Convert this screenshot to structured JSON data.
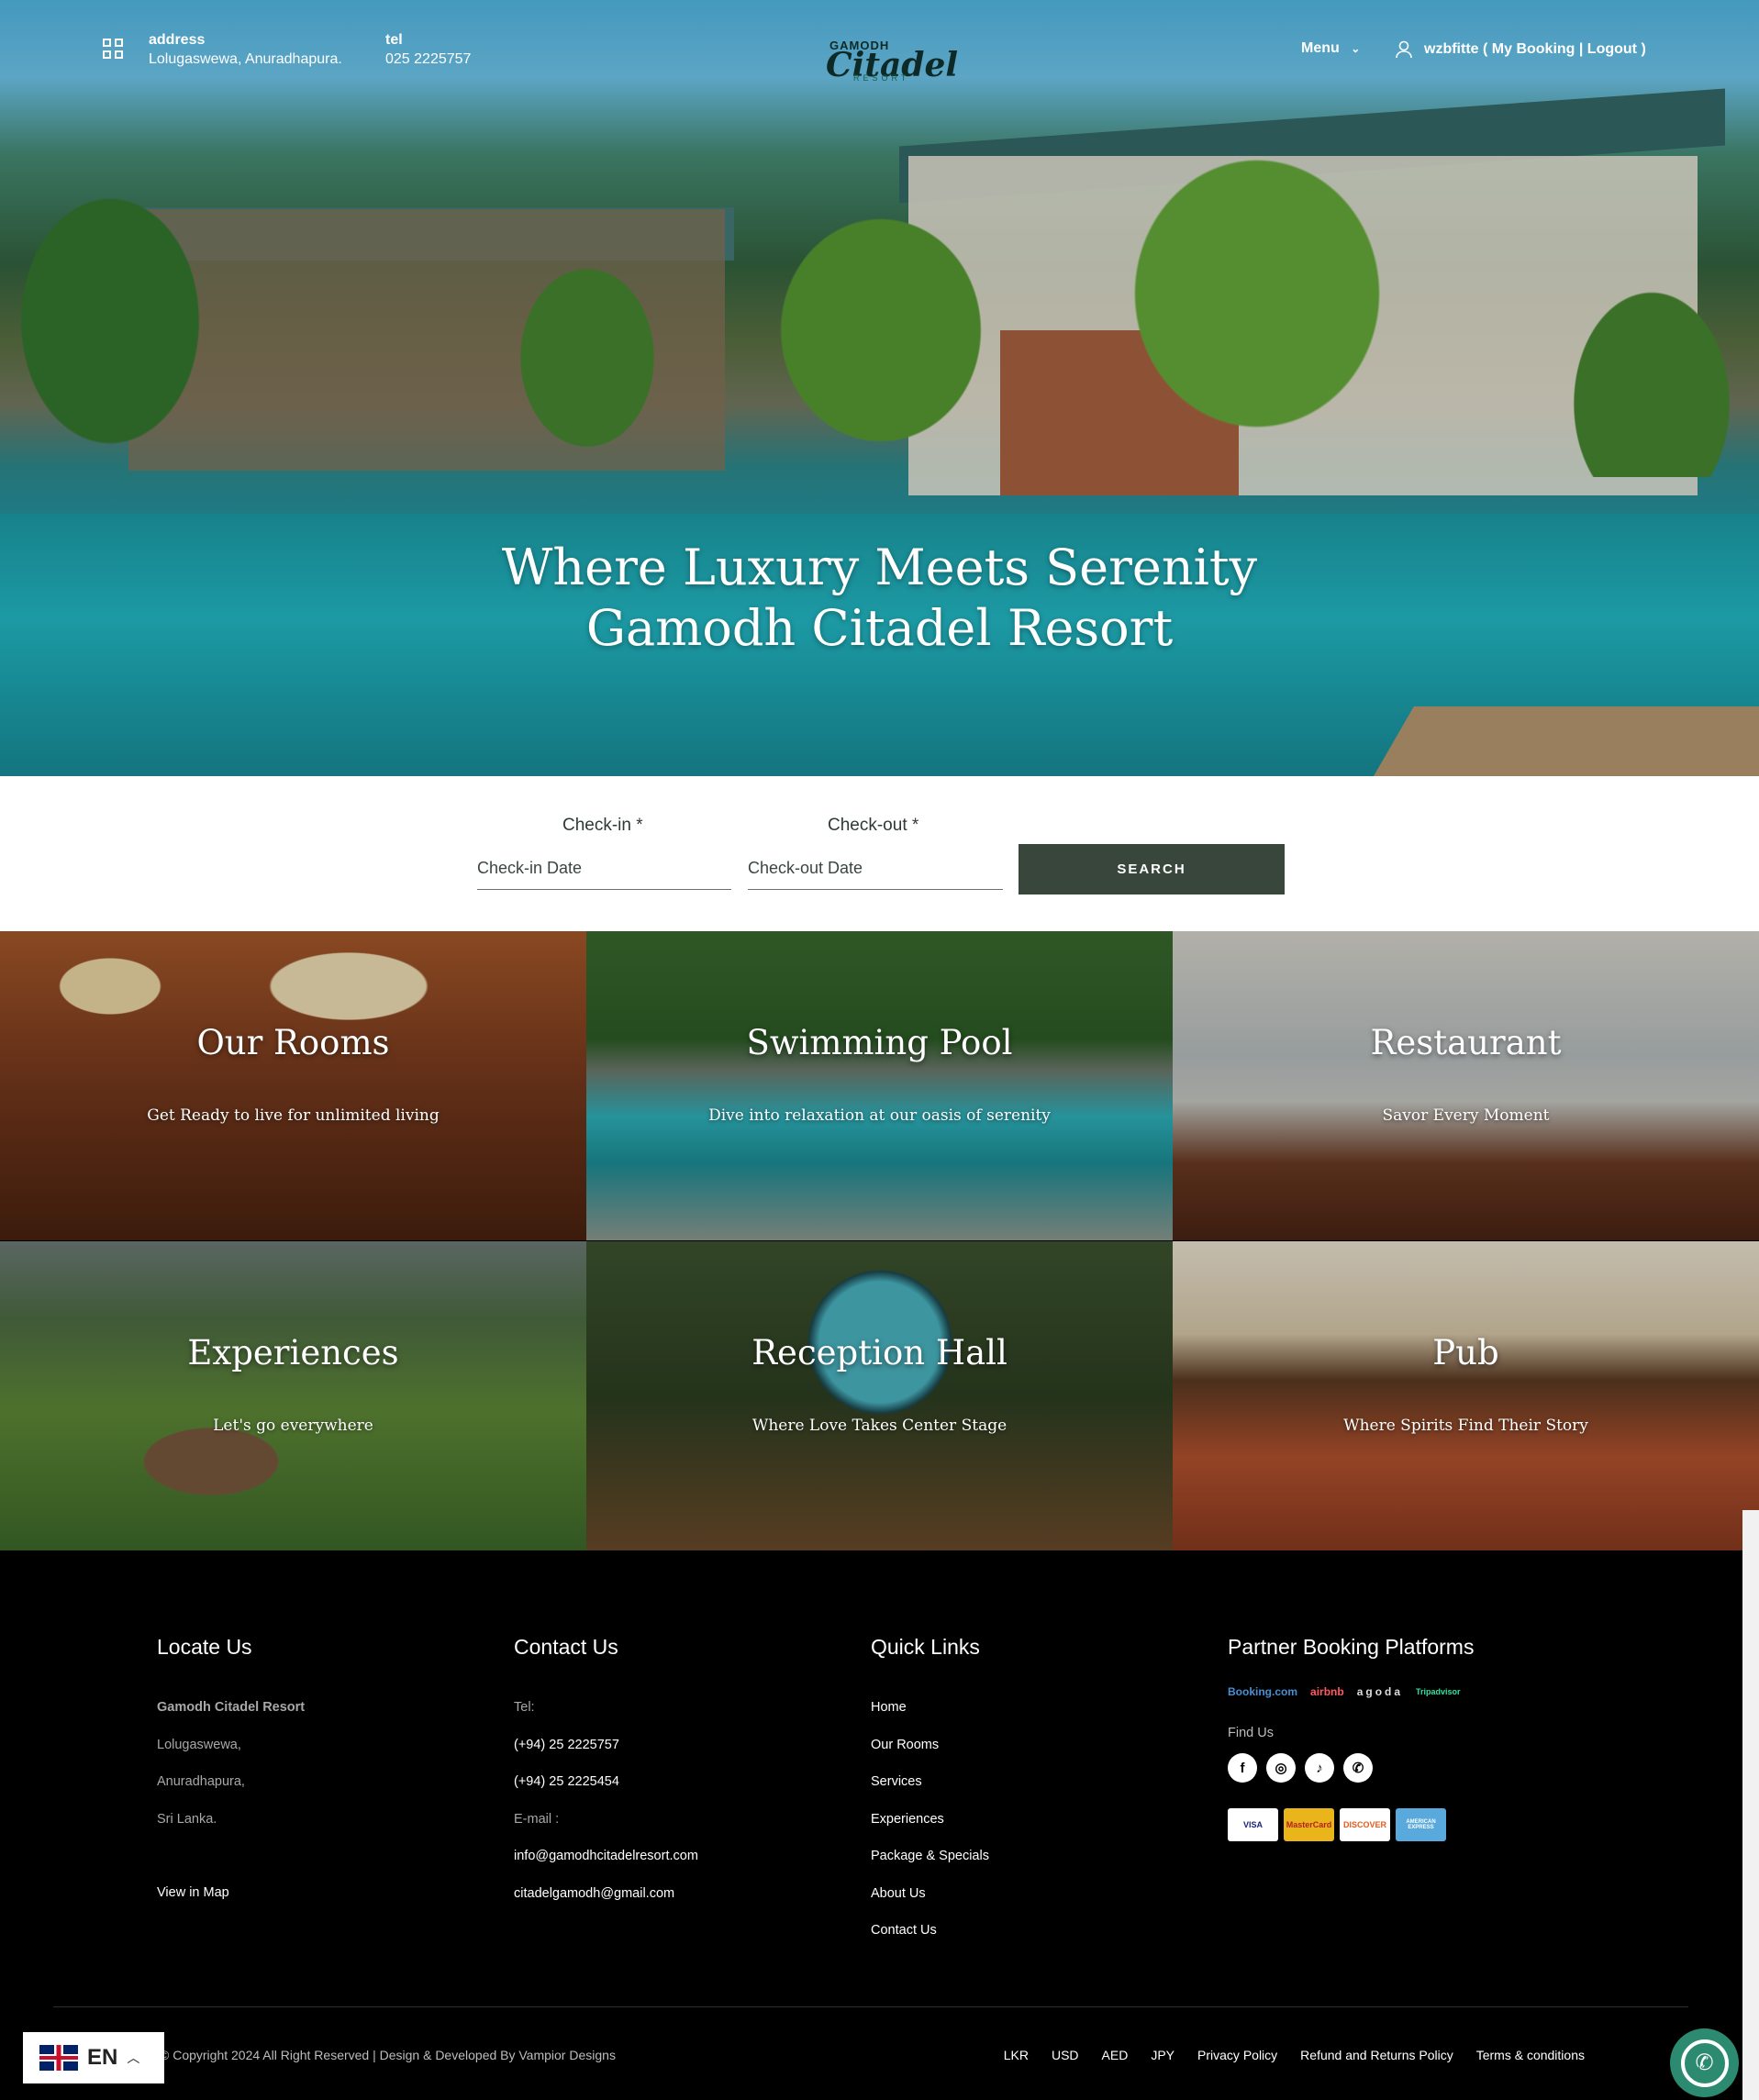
{
  "header": {
    "address_label": "address",
    "address_value": "Lolugaswewa, Anuradhapura.",
    "tel_label": "tel",
    "tel_value": "025 2225757",
    "logo_top": "GAMODH",
    "logo_main": "Citadel",
    "logo_sub": "RESORT",
    "menu_label": "Menu",
    "user_text": "wzbfitte ( My Booking | Logout )"
  },
  "hero": {
    "line1": "Where Luxury Meets Serenity",
    "line2": "Gamodh Citadel Resort"
  },
  "booking": {
    "checkin_label": "Check-in *",
    "checkin_placeholder": "Check-in Date",
    "checkout_label": "Check-out *",
    "checkout_placeholder": "Check-out Date",
    "search_label": "SEARCH"
  },
  "tiles": [
    {
      "title": "Our Rooms",
      "subtitle": "Get Ready to live for unlimited living"
    },
    {
      "title": "Swimming Pool",
      "subtitle": "Dive into relaxation at our oasis of serenity"
    },
    {
      "title": "Restaurant",
      "subtitle": "Savor Every Moment"
    },
    {
      "title": "Experiences",
      "subtitle": "Let's go everywhere"
    },
    {
      "title": "Reception Hall",
      "subtitle": "Where Love Takes Center Stage"
    },
    {
      "title": "Pub",
      "subtitle": "Where Spirits Find Their Story"
    }
  ],
  "footer": {
    "locate": {
      "heading": "Locate Us",
      "name": "Gamodh Citadel Resort",
      "line1": "Lolugaswewa,",
      "line2": "Anuradhapura,",
      "line3": "Sri Lanka.",
      "map_link": "View in Map"
    },
    "contact": {
      "heading": "Contact Us",
      "tel_label": "Tel:",
      "tel1": "(+94) 25 2225757",
      "tel2": "(+94) 25 2225454",
      "email_label": "E-mail :",
      "email1": "info@gamodhcitadelresort.com",
      "email2": "citadelgamodh@gmail.com"
    },
    "quick": {
      "heading": "Quick Links",
      "links": [
        "Home",
        "Our Rooms",
        "Services",
        "Experiences",
        "Package & Specials",
        "About Us",
        "Contact Us"
      ]
    },
    "partners": {
      "heading": "Partner Booking Platforms",
      "platforms": [
        "Booking.com",
        "airbnb",
        "agoda",
        "Tripadvisor"
      ],
      "find_us": "Find Us",
      "social": [
        {
          "icon": "facebook-icon",
          "glyph": "f"
        },
        {
          "icon": "instagram-icon",
          "glyph": "◎"
        },
        {
          "icon": "tiktok-icon",
          "glyph": "♪"
        },
        {
          "icon": "whatsapp-icon",
          "glyph": "✆"
        }
      ],
      "cards": [
        "VISA",
        "MasterCard",
        "DISCOVER",
        "AMERICAN EXPRESS"
      ]
    },
    "copyright": "© Copyright 2024 All Right Reserved | Design & Developed By Vampior Designs",
    "bottom_links": [
      "LKR",
      "USD",
      "AED",
      "JPY",
      "Privacy Policy",
      "Refund and Returns Policy",
      "Terms & conditions"
    ]
  },
  "language": {
    "code": "EN"
  },
  "colors": {
    "booking_button": "#38463c",
    "footer_bg": "#000000",
    "whatsapp": "#2b8a6f"
  }
}
